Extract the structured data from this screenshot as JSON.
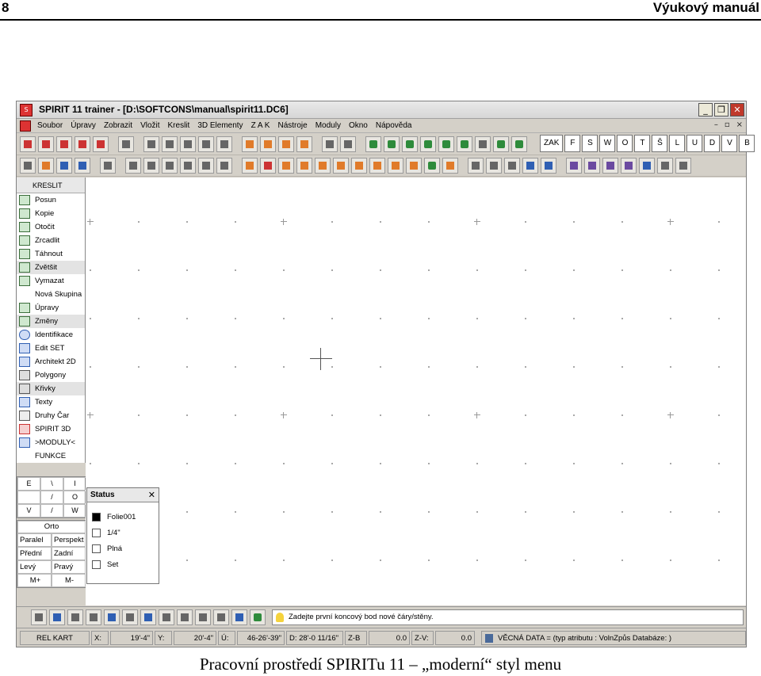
{
  "page": {
    "number": "8",
    "header_title": "Výukový manuál",
    "caption": "Pracovní prostředí SPIRITu 11 – „moderní“ styl menu"
  },
  "window": {
    "title": "SPIRIT 11 trainer - [D:\\SOFTCONS\\manual\\spirit11.DC6]",
    "buttons": {
      "minimize": "_",
      "restore": "❐",
      "close": "✕"
    },
    "mdi_buttons": {
      "minimize": "–",
      "restore": "▫",
      "close": "×"
    }
  },
  "menubar": {
    "items": [
      "Soubor",
      "Úpravy",
      "Zobrazit",
      "Vložit",
      "Kreslit",
      "3D Elementy",
      "Z A K",
      "Nástroje",
      "Moduly",
      "Okno",
      "Nápověda"
    ]
  },
  "toolbar": {
    "ortho_buttons": [
      "ZAK",
      "F",
      "S",
      "W",
      "O",
      "T",
      "Š",
      "L",
      "U",
      "D",
      "V",
      "B"
    ]
  },
  "sidebar": {
    "header": "KRESLIT",
    "items": [
      {
        "label": "Posun",
        "icon": "move-icon"
      },
      {
        "label": "Kopie",
        "icon": "copy-icon"
      },
      {
        "label": "Otočit",
        "icon": "rotate-icon"
      },
      {
        "label": "Zrcadlit",
        "icon": "mirror-icon"
      },
      {
        "label": "Táhnout",
        "icon": "stretch-icon"
      },
      {
        "label": "Zvětšit",
        "icon": "scale-icon"
      },
      {
        "label": "Vymazat",
        "icon": "delete-icon"
      },
      {
        "label": "Nová Skupina",
        "icon": ""
      },
      {
        "label": "Úpravy",
        "icon": "edit-icon"
      },
      {
        "label": "Změny",
        "icon": "change-icon"
      },
      {
        "label": "Identifikace",
        "icon": "info-icon"
      },
      {
        "label": "Edit SET",
        "icon": "editset-icon"
      },
      {
        "label": "Architekt 2D",
        "icon": "architect-icon"
      },
      {
        "label": "Polygony",
        "icon": "polygon-icon"
      },
      {
        "label": "Křivky",
        "icon": "curve-icon"
      },
      {
        "label": "Texty",
        "icon": "text-icon"
      },
      {
        "label": "Druhy Čar",
        "icon": "linetype-icon"
      },
      {
        "label": "SPIRIT 3D",
        "icon": "spirit3d-icon"
      },
      {
        "label": ">MODULY<",
        "icon": "modules-icon"
      },
      {
        "label": "FUNKCE",
        "icon": ""
      }
    ]
  },
  "viewpad": {
    "grid": [
      "E",
      "\\",
      "I",
      "",
      "/",
      "O",
      "V",
      "/",
      "W"
    ],
    "orto": "Orto",
    "buttons": [
      "Paralel",
      "Perspekt",
      "Přední",
      "Zadní",
      "Levý",
      "Pravý",
      "M+",
      "M-"
    ]
  },
  "status": {
    "title": "Status",
    "close": "✕",
    "rows": [
      {
        "label": "Folie001",
        "color": "#000000"
      },
      {
        "label": "1/4\"",
        "color": "#ffffff"
      },
      {
        "label": "Plná",
        "color": "#ffffff"
      },
      {
        "label": "Set",
        "color": "#ffffff"
      }
    ]
  },
  "hint": "Zadejte první koncový bod nové čáry/stěny.",
  "coords": {
    "mode": "REL KART",
    "x_label": "X:",
    "x_value": "19'-4\"",
    "y_label": "Y:",
    "y_value": "20'-4\"",
    "u_label": "Ú:",
    "u_value": "46-26'-39\"",
    "d_label": "D:",
    "d_value": "28'-0 11/16\"",
    "zb_label": "Z-B",
    "zb_value": "0.0",
    "zv_label": "Z-V:",
    "zv_value": "0.0",
    "attr": "VĚCNÁ DATA = (typ atributu : VolnZpůs Databáze: )"
  }
}
